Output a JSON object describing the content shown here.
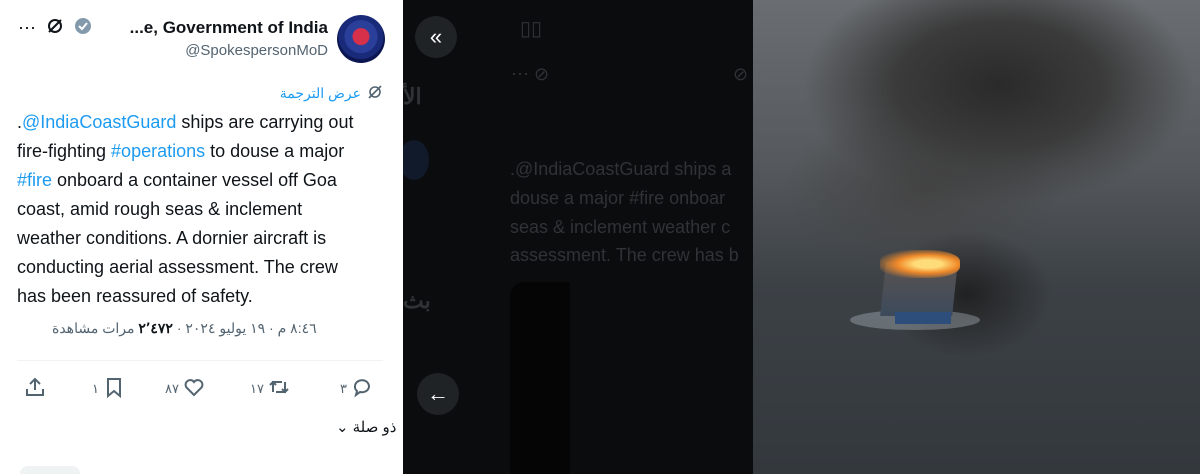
{
  "account": {
    "name": "...e, Government of India",
    "handle": "@SpokespersonMoD"
  },
  "translate_label": "عرض الترجمة",
  "tweet": {
    "l1_pre": ".",
    "l1_mention": "@IndiaCoastGuard",
    "l1_post": " ships are carrying out",
    "l2_pre": "fire-fighting ",
    "l2_tag": "#operations",
    "l2_post": " to douse a major",
    "l3_tag": "#fire",
    "l3_post": " onboard a container vessel off Goa",
    "l4": "coast, amid rough seas & inclement",
    "l5": "weather conditions. A dornier aircraft is",
    "l6": "conducting aerial assessment. The crew",
    "l7": "has been reassured of safety."
  },
  "meta": {
    "time": "٨:٤٦ م",
    "date": "١٩ يوليو ٢٠٢٤",
    "views_count": "٢٬٤٧٢",
    "views_label": "مرات مشاهدة",
    "sep": "·"
  },
  "actions": {
    "replies": "٣",
    "reposts": "١٧",
    "likes": "٨٧",
    "bookmarks": "١"
  },
  "related_label": "ذو صلة",
  "background_ghost": {
    "line1": ".@IndiaCoastGuard ships a",
    "line2": "douse a major #fire onboar",
    "line3": "seas & inclement weather c",
    "line4": "assessment. The crew has b",
    "arabic_a": "الأ",
    "arabic_b": "بث"
  }
}
